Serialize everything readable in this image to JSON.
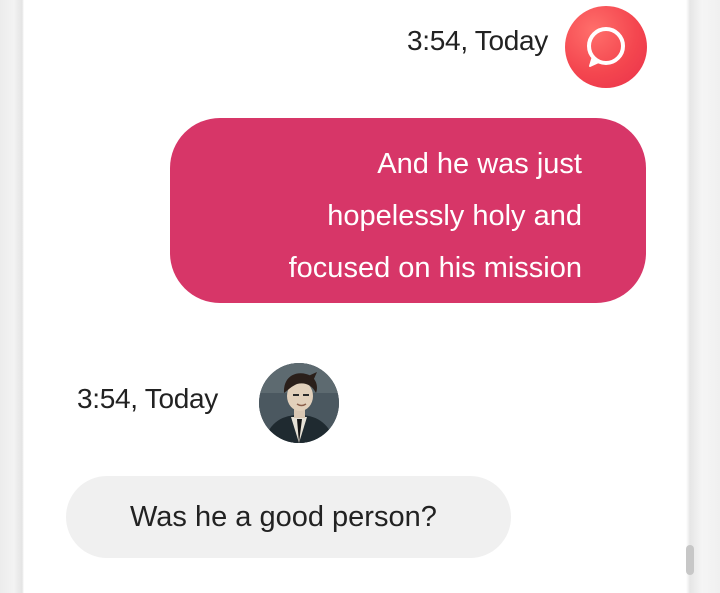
{
  "conversation": {
    "sent": {
      "timestamp": "3:54, Today",
      "lines": [
        "And he was just",
        "hopelessly holy and",
        "focused on his mission"
      ],
      "bubble_color": "#d73668"
    },
    "received": {
      "timestamp": "3:54, Today",
      "text": "Was he a good person?",
      "bubble_color": "#f0f0f0"
    }
  },
  "icons": {
    "app_avatar": "chat-bubble-icon",
    "user_avatar": "character-portrait"
  },
  "colors": {
    "app_avatar": "#f4464f",
    "text": "#222222"
  }
}
